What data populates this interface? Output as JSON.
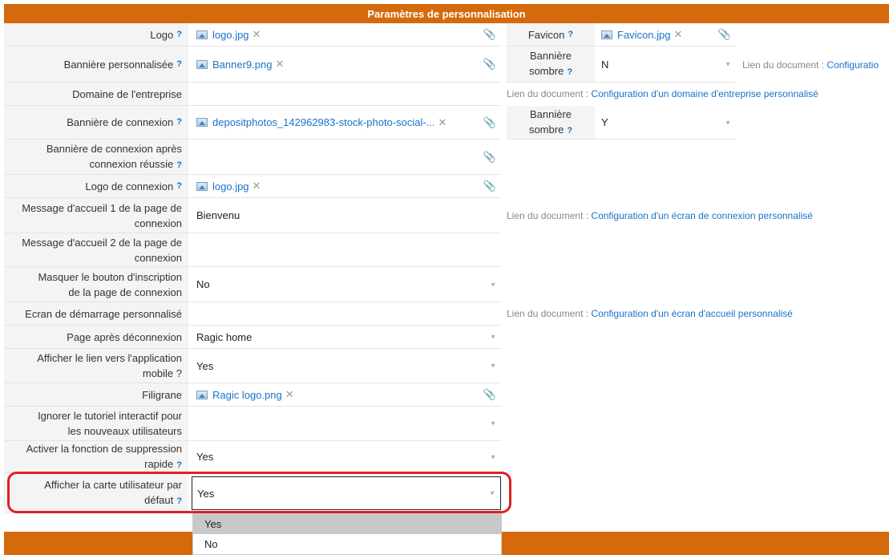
{
  "header": {
    "title": "Paramètres de personnalisation"
  },
  "rows": {
    "logo": {
      "label": "Logo",
      "file": "logo.jpg"
    },
    "banner": {
      "label": "Bannière personnalisée",
      "file": "Banner9.png"
    },
    "domain": {
      "label": "Domaine de l'entreprise"
    },
    "login_banner": {
      "label": "Bannière de connexion",
      "file": "depositphotos_142962983-stock-photo-social-..."
    },
    "login_banner_after": {
      "label1": "Bannière de connexion après",
      "label2": "connexion réussie"
    },
    "login_logo": {
      "label": "Logo de connexion",
      "file": "logo.jpg"
    },
    "welcome1": {
      "label1": "Message d'accueil 1 de la page de",
      "label2": "connexion",
      "value": "Bienvenu"
    },
    "welcome2": {
      "label1": "Message d'accueil 2 de la page de",
      "label2": "connexion"
    },
    "hide_signup": {
      "label1": "Masquer le bouton d'inscription",
      "label2": "de la page de connexion",
      "value": "No"
    },
    "splash": {
      "label": "Ecran de démarrage personnalisé"
    },
    "after_logout": {
      "label": "Page après déconnexion",
      "value": "Ragic home"
    },
    "mobile_link": {
      "label1": "Afficher le lien vers l'application",
      "label2": "mobile ?",
      "value": "Yes"
    },
    "watermark": {
      "label": "Filigrane",
      "file": "Ragic logo.png"
    },
    "tutorial": {
      "label1": "Ignorer le tutoriel interactif pour",
      "label2": "les nouveaux utilisateurs"
    },
    "quick_delete": {
      "label1": "Activer la fonction de suppression",
      "label2": "rapide",
      "value": "Yes"
    },
    "user_card": {
      "label1": "Afficher la carte utilisateur par",
      "label2": "défaut",
      "value": "Yes"
    }
  },
  "right": {
    "favicon": {
      "label": "Favicon",
      "file": "Favicon.jpg"
    },
    "dark_banner_1": {
      "label1": "Bannière",
      "label2": "sombre",
      "value": "N"
    },
    "dark_banner_2": {
      "label1": "Bannière",
      "label2": "sombre",
      "value": "Y"
    }
  },
  "doc_links": {
    "prefix": "Lien du document :",
    "banner": "Configuratio",
    "domain": "Configuration d'un domaine d'entreprise personnalisé",
    "login_screen": "Configuration d'un écran de connexion personnalisé",
    "splash": "Configuration d'un écran d'accueil personnalisé"
  },
  "help_mark": "?",
  "dropdown": {
    "options": [
      "Yes",
      "No"
    ],
    "selected": "Yes"
  },
  "colors": {
    "header_bg": "#d46a0c",
    "link": "#1a73c8",
    "highlight": "#e02020"
  }
}
